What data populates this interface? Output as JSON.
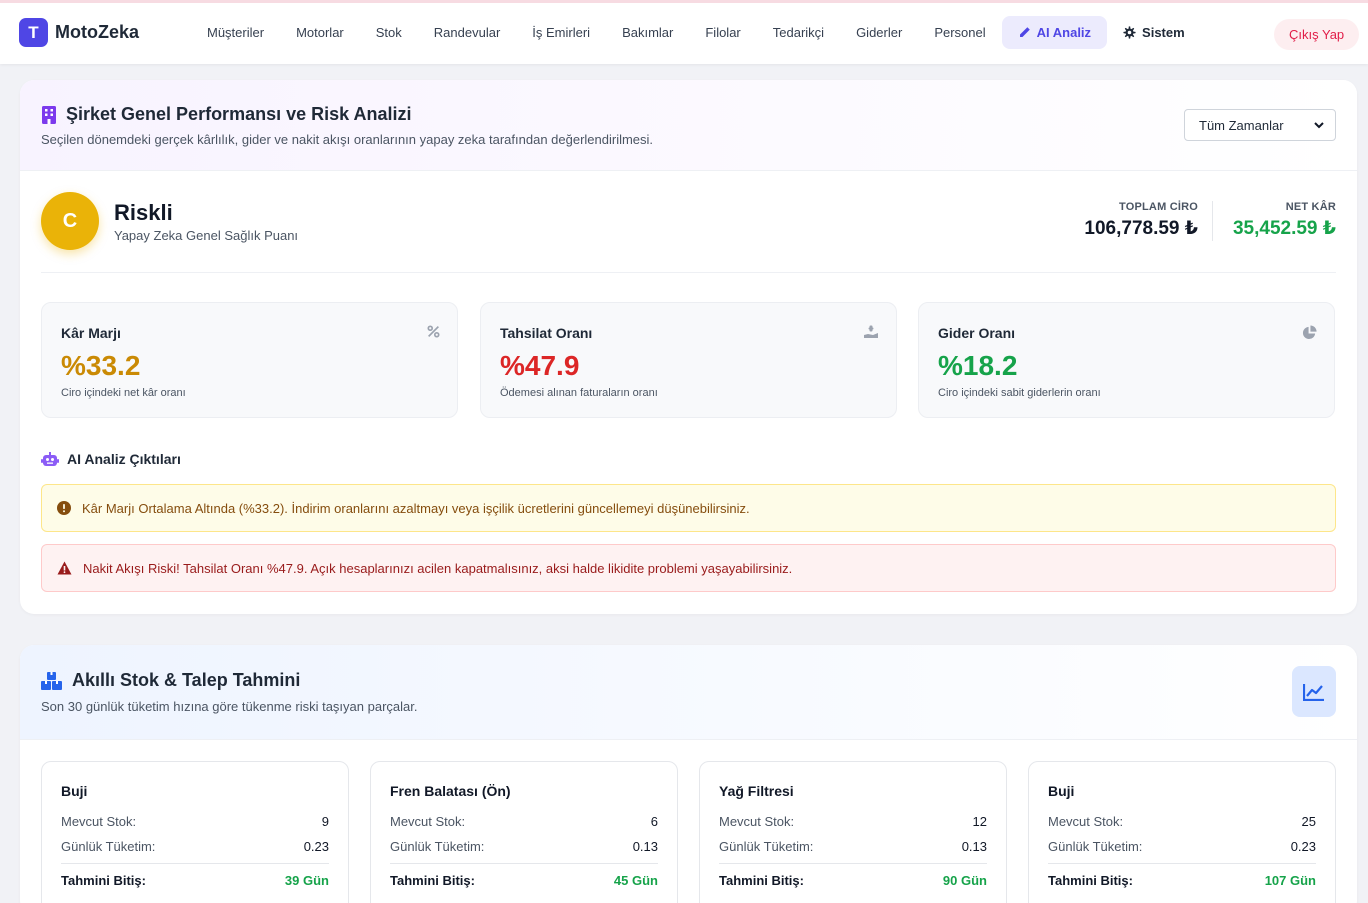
{
  "app": {
    "logo_letter": "T",
    "name": "MotoZeka"
  },
  "nav": {
    "items": [
      {
        "label": "Müşteriler"
      },
      {
        "label": "Motorlar"
      },
      {
        "label": "Stok"
      },
      {
        "label": "Randevular"
      },
      {
        "label": "İş Emirleri"
      },
      {
        "label": "Bakımlar"
      },
      {
        "label": "Filolar"
      },
      {
        "label": "Tedarikçi"
      },
      {
        "label": "Giderler"
      },
      {
        "label": "Personel"
      }
    ],
    "ai_label": "AI Analiz",
    "system_label": "Sistem",
    "logout_label": "Çıkış Yap"
  },
  "performance": {
    "title": "Şirket Genel Performansı ve Risk Analizi",
    "subtitle": "Seçilen dönemdeki gerçek kârlılık, gider ve nakit akışı oranlarının yapay zeka tarafından değerlendirilmesi.",
    "period_selected": "Tüm Zamanlar",
    "score": {
      "grade": "C",
      "status": "Riskli",
      "label": "Yapay Zeka Genel Sağlık Puanı"
    },
    "revenue": {
      "label": "TOPLAM CİRO",
      "value": "106,778.59 ₺"
    },
    "net_profit": {
      "label": "NET KÂR",
      "value": "35,452.59 ₺"
    },
    "metrics": [
      {
        "label": "Kâr Marjı",
        "value": "%33.2",
        "note": "Ciro içindeki net kâr oranı",
        "icon": "percent-icon"
      },
      {
        "label": "Tahsilat Oranı",
        "value": "%47.9",
        "note": "Ödemesi alınan faturaların oranı",
        "icon": "hand-holding-dollar-icon"
      },
      {
        "label": "Gider Oranı",
        "value": "%18.2",
        "note": "Ciro içindeki sabit giderlerin oranı",
        "icon": "pie-chart-icon"
      }
    ],
    "ai_outputs_title": "AI Analiz Çıktıları",
    "alerts": {
      "warning": "Kâr Marjı Ortalama Altında (%33.2). İndirim oranlarını azaltmayı veya işçilik ücretlerini güncellemeyi düşünebilirsiniz.",
      "danger": "Nakit Akışı Riski! Tahsilat Oranı %47.9. Açık hesaplarınızı acilen kapatmalısınız, aksi halde likidite problemi yaşayabilirsiniz."
    },
    "colors": {
      "warning": "#ca8a04",
      "danger": "#dc2626",
      "success": "#16a34a",
      "accent": "#4f46e5"
    }
  },
  "stock": {
    "title": "Akıllı Stok & Talep Tahmini",
    "subtitle": "Son 30 günlük tüketim hızına göre tükenme riski taşıyan parçalar.",
    "labels": {
      "current": "Mevcut Stok:",
      "daily": "Günlük Tüketim:",
      "estimate": "Tahmini Bitiş:"
    },
    "items": [
      {
        "name": "Buji",
        "current": "9",
        "daily": "0.23",
        "estimate": "39 Gün"
      },
      {
        "name": "Fren Balatası (Ön)",
        "current": "6",
        "daily": "0.13",
        "estimate": "45 Gün"
      },
      {
        "name": "Yağ Filtresi",
        "current": "12",
        "daily": "0.13",
        "estimate": "90 Gün"
      },
      {
        "name": "Buji",
        "current": "25",
        "daily": "0.23",
        "estimate": "107 Gün"
      }
    ]
  }
}
